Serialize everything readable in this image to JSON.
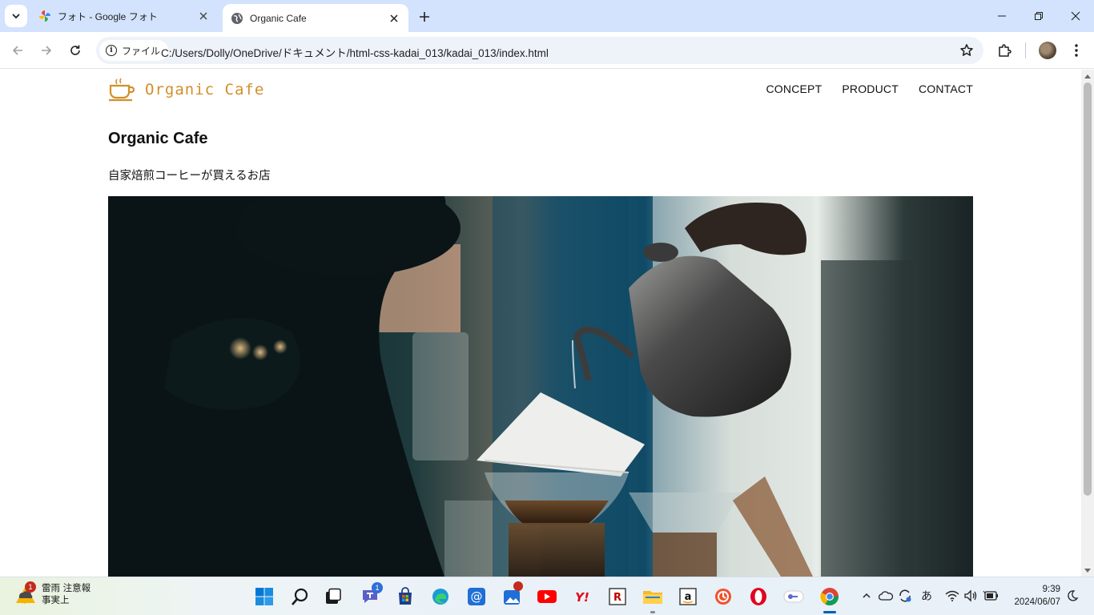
{
  "browser": {
    "tabs": [
      {
        "title": "フォト - Google フォト",
        "active": false
      },
      {
        "title": "Organic Cafe",
        "active": true
      }
    ],
    "address": {
      "chip_label": "ファイル",
      "url": "C:/Users/Dolly/OneDrive/ドキュメント/html-css-kadai_013/kadai_013/index.html"
    }
  },
  "site": {
    "logo_text": "Organic Cafe",
    "nav": [
      {
        "label": "CONCEPT"
      },
      {
        "label": "PRODUCT"
      },
      {
        "label": "CONTACT"
      }
    ],
    "hero_title": "Organic Cafe",
    "hero_subtitle": "自家焙煎コーヒーが買えるお店",
    "accent_color": "#d28f2a"
  },
  "taskbar": {
    "weather_badge": "1",
    "weather_line1": "雷雨 注意報",
    "weather_line2": "事実上",
    "teams_badge": "1",
    "ime_label": "あ",
    "time": "9:39",
    "date": "2024/06/07"
  }
}
